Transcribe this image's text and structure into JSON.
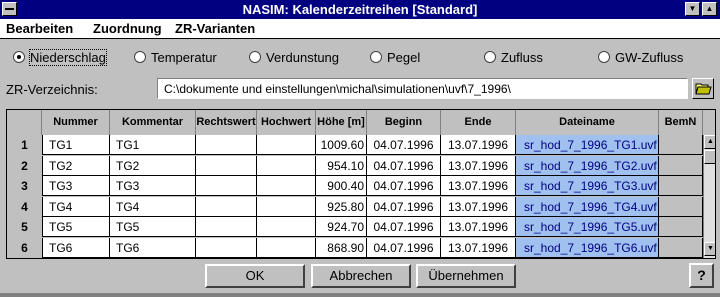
{
  "window": {
    "title": "NASIM: Kalenderzeitreihen [Standard]"
  },
  "menu": [
    "Bearbeiten",
    "Zuordnung",
    "ZR-Varianten"
  ],
  "radios": [
    {
      "label": "Niederschlag",
      "selected": true
    },
    {
      "label": "Temperatur",
      "selected": false
    },
    {
      "label": "Verdunstung",
      "selected": false
    },
    {
      "label": "Pegel",
      "selected": false
    },
    {
      "label": "Zufluss",
      "selected": false
    },
    {
      "label": "GW-Zufluss",
      "selected": false
    }
  ],
  "directory": {
    "label": "ZR-Verzeichnis:",
    "value": "C:\\dokumente und einstellungen\\michal\\simulationen\\uvf\\7_1996\\"
  },
  "table": {
    "columns": [
      "Nummer",
      "Kommentar",
      "Rechtswert",
      "Hochwert",
      "Höhe [m]",
      "Beginn",
      "Ende",
      "Dateiname",
      "BemN"
    ],
    "rows": [
      {
        "n": "1",
        "nummer": "TG1",
        "kommentar": "TG1",
        "rechtswert": "",
        "hochwert": "",
        "hoehe": "1009.60",
        "beginn": "04.07.1996",
        "ende": "13.07.1996",
        "datei": "sr_hod_7_1996_TG1.uvf",
        "bem": ""
      },
      {
        "n": "2",
        "nummer": "TG2",
        "kommentar": "TG2",
        "rechtswert": "",
        "hochwert": "",
        "hoehe": "954.10",
        "beginn": "04.07.1996",
        "ende": "13.07.1996",
        "datei": "sr_hod_7_1996_TG2.uvf",
        "bem": ""
      },
      {
        "n": "3",
        "nummer": "TG3",
        "kommentar": "TG3",
        "rechtswert": "",
        "hochwert": "",
        "hoehe": "900.40",
        "beginn": "04.07.1996",
        "ende": "13.07.1996",
        "datei": "sr_hod_7_1996_TG3.uvf",
        "bem": ""
      },
      {
        "n": "4",
        "nummer": "TG4",
        "kommentar": "TG4",
        "rechtswert": "",
        "hochwert": "",
        "hoehe": "925.80",
        "beginn": "04.07.1996",
        "ende": "13.07.1996",
        "datei": "sr_hod_7_1996_TG4.uvf",
        "bem": ""
      },
      {
        "n": "5",
        "nummer": "TG5",
        "kommentar": "TG5",
        "rechtswert": "",
        "hochwert": "",
        "hoehe": "924.70",
        "beginn": "04.07.1996",
        "ende": "13.07.1996",
        "datei": "sr_hod_7_1996_TG5.uvf",
        "bem": ""
      },
      {
        "n": "6",
        "nummer": "TG6",
        "kommentar": "TG6",
        "rechtswert": "",
        "hochwert": "",
        "hoehe": "868.90",
        "beginn": "04.07.1996",
        "ende": "13.07.1996",
        "datei": "sr_hod_7_1996_TG6.uvf",
        "bem": ""
      }
    ]
  },
  "buttons": {
    "ok": "OK",
    "cancel": "Abbrechen",
    "apply": "Übernehmen",
    "help": "?"
  },
  "icons": {
    "browse": "folder-open-icon"
  },
  "colors": {
    "titlebar": "#000080",
    "selection": "#a0c0f0",
    "face": "#c0c0c0"
  }
}
